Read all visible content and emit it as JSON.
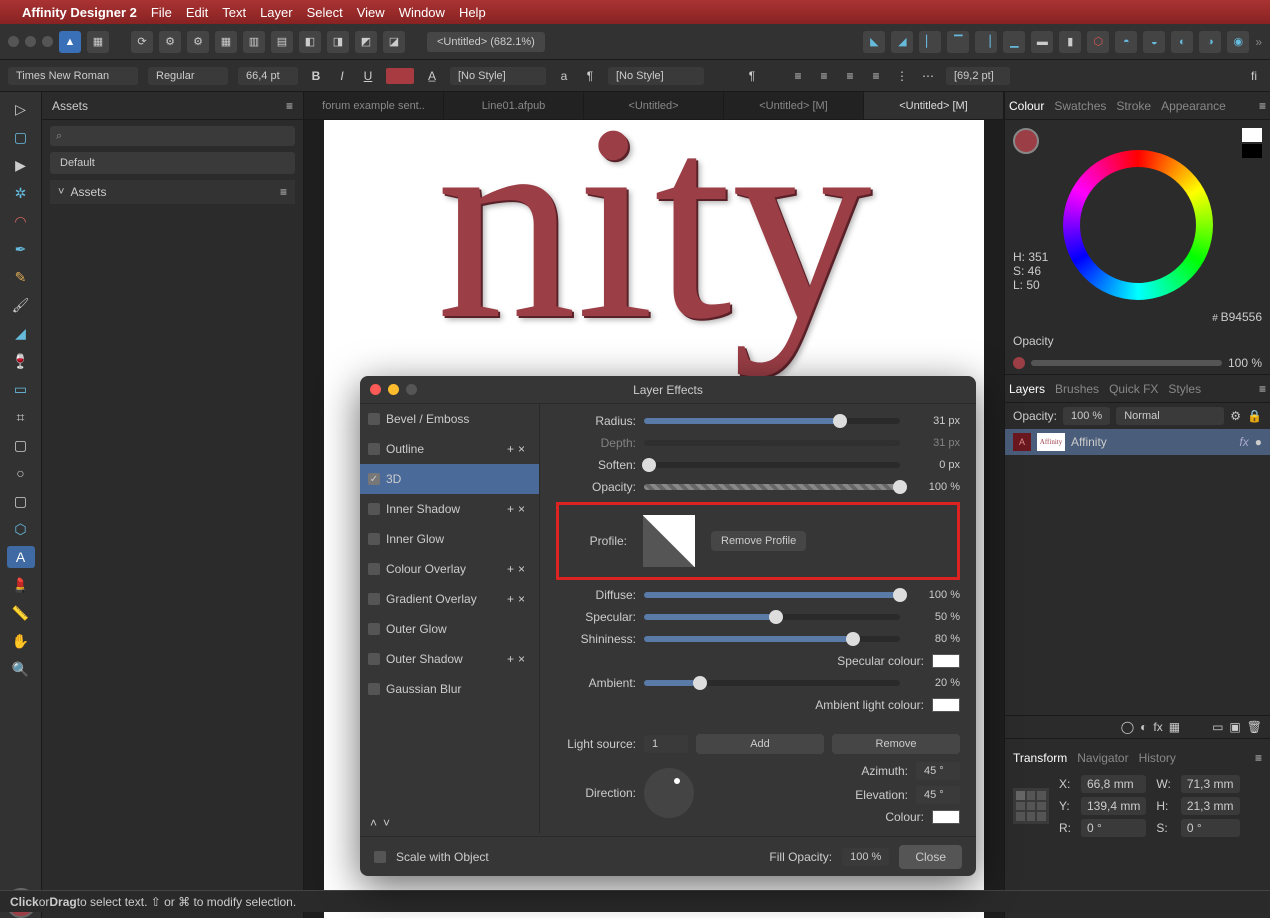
{
  "menubar": {
    "app": "Affinity Designer 2",
    "items": [
      "File",
      "Edit",
      "Text",
      "Layer",
      "Select",
      "View",
      "Window",
      "Help"
    ]
  },
  "toolbar": {
    "doc_title": "<Untitled> (682.1%)"
  },
  "contextbar": {
    "font": "Times New Roman",
    "style": "Regular",
    "size": "66,4 pt",
    "charstyle": "[No Style]",
    "parastyle": "[No Style]",
    "leading": "[69,2 pt]"
  },
  "tabs": [
    "forum example sent..",
    "Line01.afpub",
    "<Untitled>",
    "<Untitled> [M]",
    "<Untitled> [M]"
  ],
  "canvas_text": "nity",
  "assets": {
    "title": "Assets",
    "default": "Default",
    "section": "Assets"
  },
  "colour": {
    "tabs": [
      "Colour",
      "Swatches",
      "Stroke",
      "Appearance"
    ],
    "h": "H: 351",
    "s": "S: 46",
    "l": "L: 50",
    "hex": "B94556",
    "opacity_label": "Opacity",
    "opacity_val": "100 %"
  },
  "layers": {
    "tabs": [
      "Layers",
      "Brushes",
      "Quick FX",
      "Styles"
    ],
    "opacity_label": "Opacity:",
    "opacity_val": "100 %",
    "blend": "Normal",
    "layer_name": "Affinity"
  },
  "transform": {
    "title": "Transform",
    "nav_tabs": [
      "Navigator",
      "History"
    ],
    "x_label": "X:",
    "x": "66,8 mm",
    "w_label": "W:",
    "w": "71,3 mm",
    "y_label": "Y:",
    "y": "139,4 mm",
    "h_label": "H:",
    "h": "21,3 mm",
    "r_label": "R:",
    "r": "0 °",
    "s_label": "S:",
    "s": "0 °"
  },
  "dialog": {
    "title": "Layer Effects",
    "effects": [
      {
        "name": "Bevel / Emboss",
        "on": false,
        "ops": false
      },
      {
        "name": "Outline",
        "on": false,
        "ops": true
      },
      {
        "name": "3D",
        "on": true,
        "ops": false,
        "selected": true
      },
      {
        "name": "Inner Shadow",
        "on": false,
        "ops": true
      },
      {
        "name": "Inner Glow",
        "on": false,
        "ops": false
      },
      {
        "name": "Colour Overlay",
        "on": false,
        "ops": true
      },
      {
        "name": "Gradient Overlay",
        "on": false,
        "ops": true
      },
      {
        "name": "Outer Glow",
        "on": false,
        "ops": false
      },
      {
        "name": "Outer Shadow",
        "on": false,
        "ops": true
      },
      {
        "name": "Gaussian Blur",
        "on": false,
        "ops": false
      }
    ],
    "params": {
      "radius_label": "Radius:",
      "radius": "31 px",
      "radius_pct": 75,
      "depth_label": "Depth:",
      "depth": "31 px",
      "soften_label": "Soften:",
      "soften": "0 px",
      "soften_pct": 0,
      "opacity_label": "Opacity:",
      "opacity": "100 %",
      "opacity_pct": 100,
      "profile_label": "Profile:",
      "remove_profile": "Remove Profile",
      "diffuse_label": "Diffuse:",
      "diffuse": "100 %",
      "diffuse_pct": 100,
      "specular_label": "Specular:",
      "specular": "50 %",
      "specular_pct": 50,
      "shininess_label": "Shininess:",
      "shininess": "80 %",
      "shininess_pct": 80,
      "spec_colour_label": "Specular colour:",
      "ambient_label": "Ambient:",
      "ambient": "20 %",
      "ambient_pct": 20,
      "amb_colour_label": "Ambient light colour:",
      "light_label": "Light source:",
      "light_idx": "1",
      "add": "Add",
      "remove": "Remove",
      "direction_label": "Direction:",
      "azimuth_label": "Azimuth:",
      "azimuth": "45 °",
      "elevation_label": "Elevation:",
      "elevation": "45 °",
      "colour_label": "Colour:"
    },
    "scale_label": "Scale with Object",
    "fillop_label": "Fill Opacity:",
    "fillop": "100 %",
    "close": "Close"
  },
  "status": {
    "text_a": "Click",
    "text_b": " or ",
    "text_c": "Drag",
    "text_d": " to select text. ⇧ or ⌘ to modify selection."
  }
}
